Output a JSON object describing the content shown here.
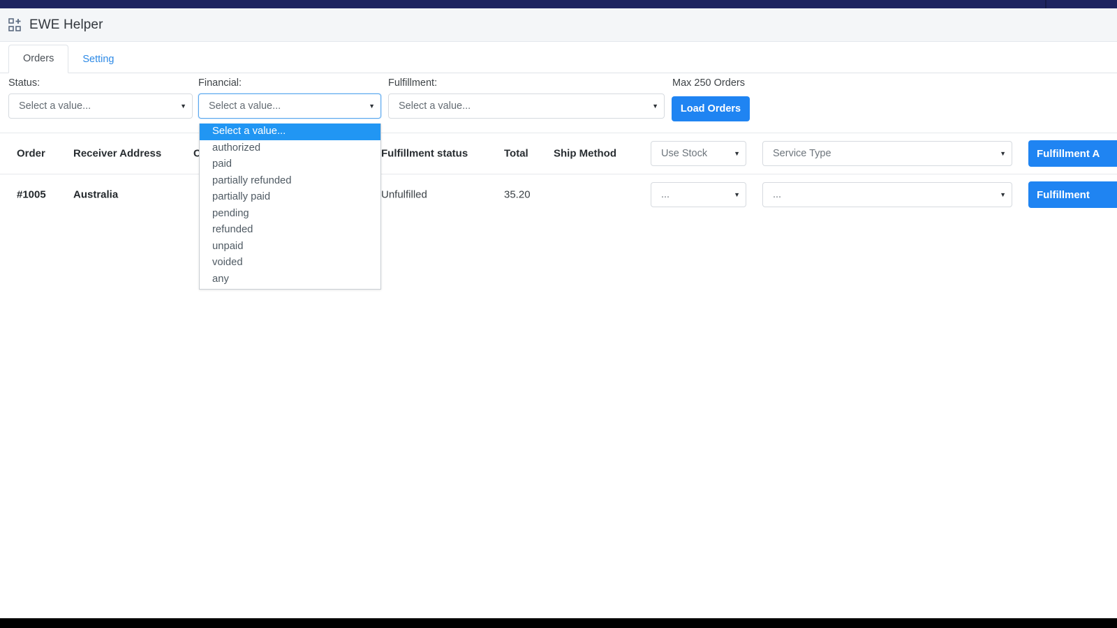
{
  "app": {
    "title": "EWE Helper",
    "icon": "grid-add-icon"
  },
  "tabs": [
    {
      "label": "Orders",
      "active": true
    },
    {
      "label": "Setting",
      "active": false
    }
  ],
  "filters": {
    "status": {
      "label": "Status:",
      "placeholder": "Select a value...",
      "value": "Select a value..."
    },
    "financial": {
      "label": "Financial:",
      "placeholder": "Select a value...",
      "value": "Select a value...",
      "focused": true,
      "open": true,
      "options": [
        "Select a value...",
        "authorized",
        "paid",
        "partially refunded",
        "partially paid",
        "pending",
        "refunded",
        "unpaid",
        "voided",
        "any"
      ],
      "selected_option": "Select a value..."
    },
    "fulfillment": {
      "label": "Fulfillment:",
      "placeholder": "Select a value...",
      "value": "Select a value..."
    },
    "max_orders_label": "Max 250 Orders",
    "load_orders_label": "Load Orders"
  },
  "table": {
    "headers": {
      "order": "Order",
      "receiver_address": "Receiver Address",
      "created": "C",
      "fulfillment_status": "Fulfillment status",
      "total": "Total",
      "ship_method": "Ship Method",
      "use_stock": "Use Stock",
      "service_type": "Service Type",
      "fulfillment_all": "Fulfillment A"
    },
    "rows": [
      {
        "order": "#1005",
        "receiver_address": "Australia",
        "created": "",
        "fulfillment_status": "Unfulfilled",
        "total": "35.20",
        "ship_method": "",
        "use_stock": "...",
        "service_type": "...",
        "fulfillment_button": "Fulfillment"
      }
    ]
  },
  "colors": {
    "navy": "#1e2460",
    "accent_blue": "#1f84f2",
    "highlight_blue": "#2196f3",
    "link_blue": "#2e8ae6"
  }
}
